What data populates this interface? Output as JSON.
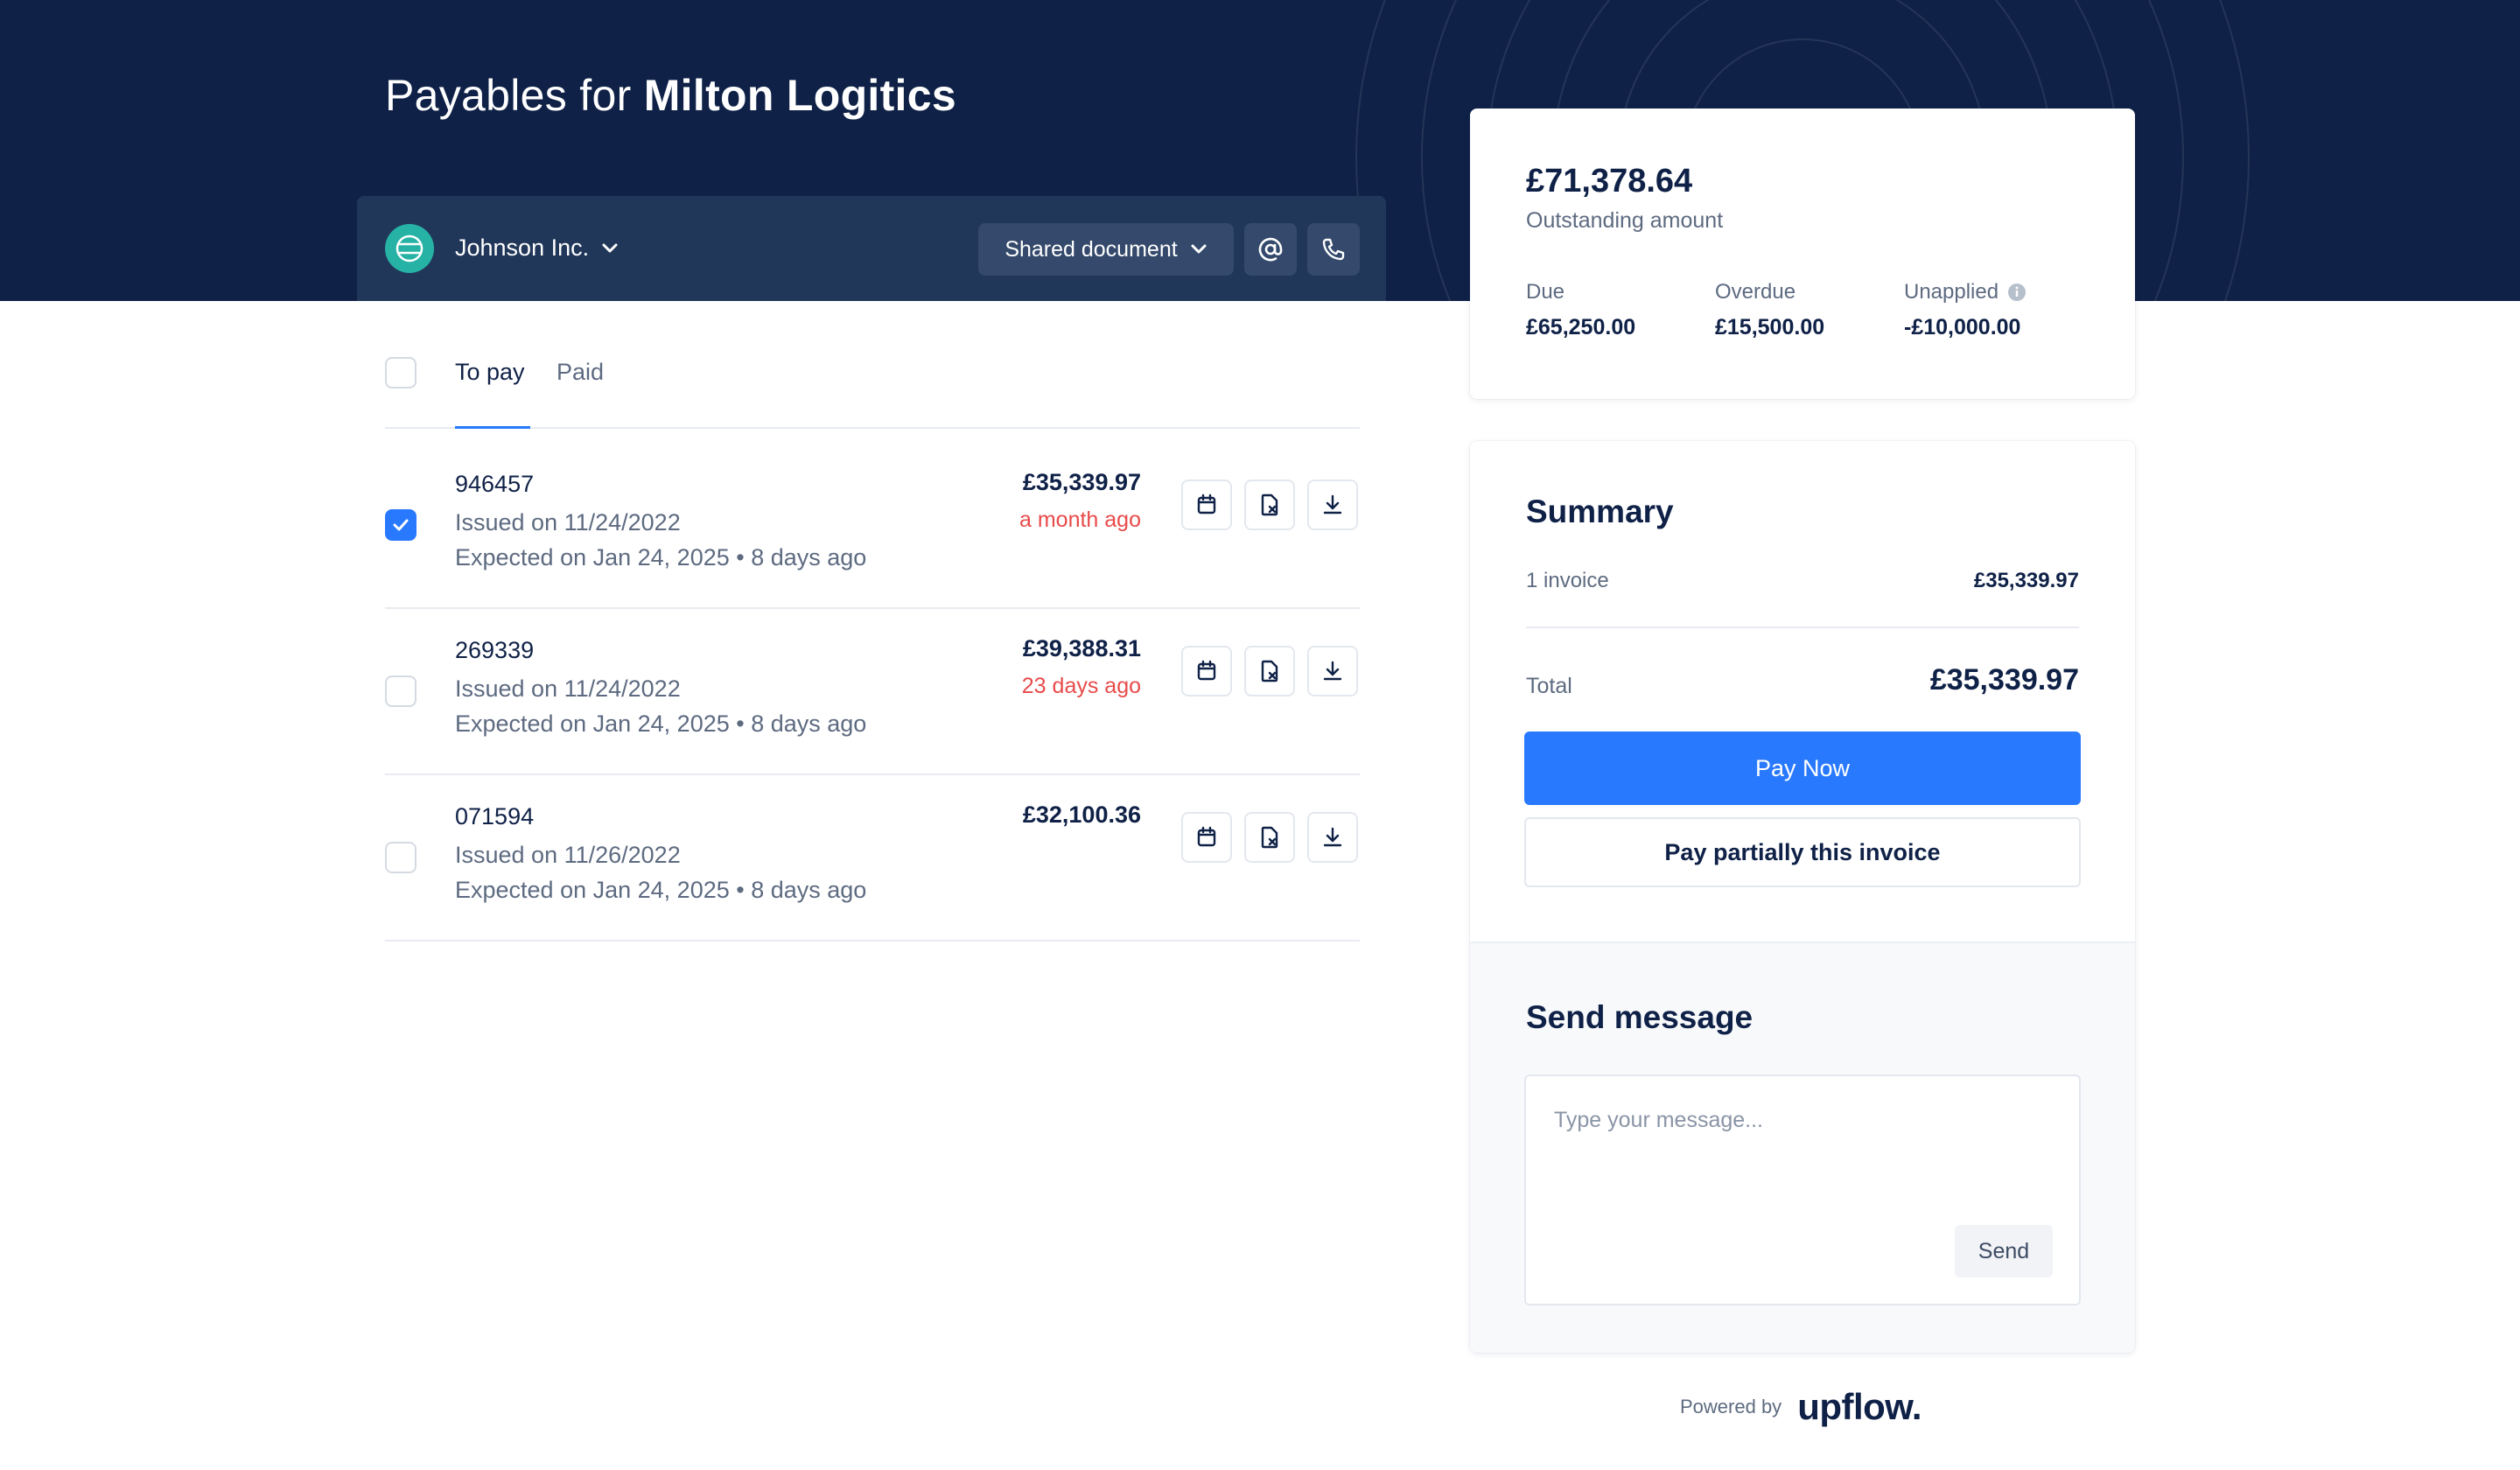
{
  "header": {
    "title_prefix": "Payables for",
    "company": "Milton Logitics"
  },
  "customer": {
    "name": "Johnson Inc.",
    "shared_document_label": "Shared document"
  },
  "tabs": [
    {
      "label": "To pay",
      "active": true
    },
    {
      "label": "Paid",
      "active": false
    }
  ],
  "invoices": [
    {
      "number": "946457",
      "issued": "Issued on 11/24/2022",
      "expected": "Expected on Jan 24, 2025 • 8 days ago",
      "amount": "£35,339.97",
      "age": "a month ago",
      "checked": true
    },
    {
      "number": "269339",
      "issued": "Issued on 11/24/2022",
      "expected": "Expected on Jan 24, 2025 • 8 days ago",
      "amount": "£39,388.31",
      "age": "23 days ago",
      "checked": false
    },
    {
      "number": "071594",
      "issued": "Issued on 11/26/2022",
      "expected": "Expected on Jan 24, 2025 • 8 days ago",
      "amount": "£32,100.36",
      "age": "",
      "checked": false
    }
  ],
  "outstanding": {
    "amount": "£71,378.64",
    "label": "Outstanding amount",
    "due_label": "Due",
    "due_value": "£65,250.00",
    "overdue_label": "Overdue",
    "overdue_value": "£15,500.00",
    "unapplied_label": "Unapplied",
    "unapplied_value": "-£10,000.00"
  },
  "summary": {
    "title": "Summary",
    "count_label": "1 invoice",
    "count_value": "£35,339.97",
    "total_label": "Total",
    "total_value": "£35,339.97",
    "pay_now_label": "Pay Now",
    "pay_partial_label": "Pay partially this invoice"
  },
  "message": {
    "title": "Send message",
    "placeholder": "Type your message...",
    "send_label": "Send"
  },
  "footer": {
    "powered_label": "Powered by",
    "brand": "upflow."
  },
  "colors": {
    "navy": "#0f2147",
    "accent": "#2979ff",
    "danger": "#e84a4a",
    "logo_teal": "#26b3a6"
  }
}
